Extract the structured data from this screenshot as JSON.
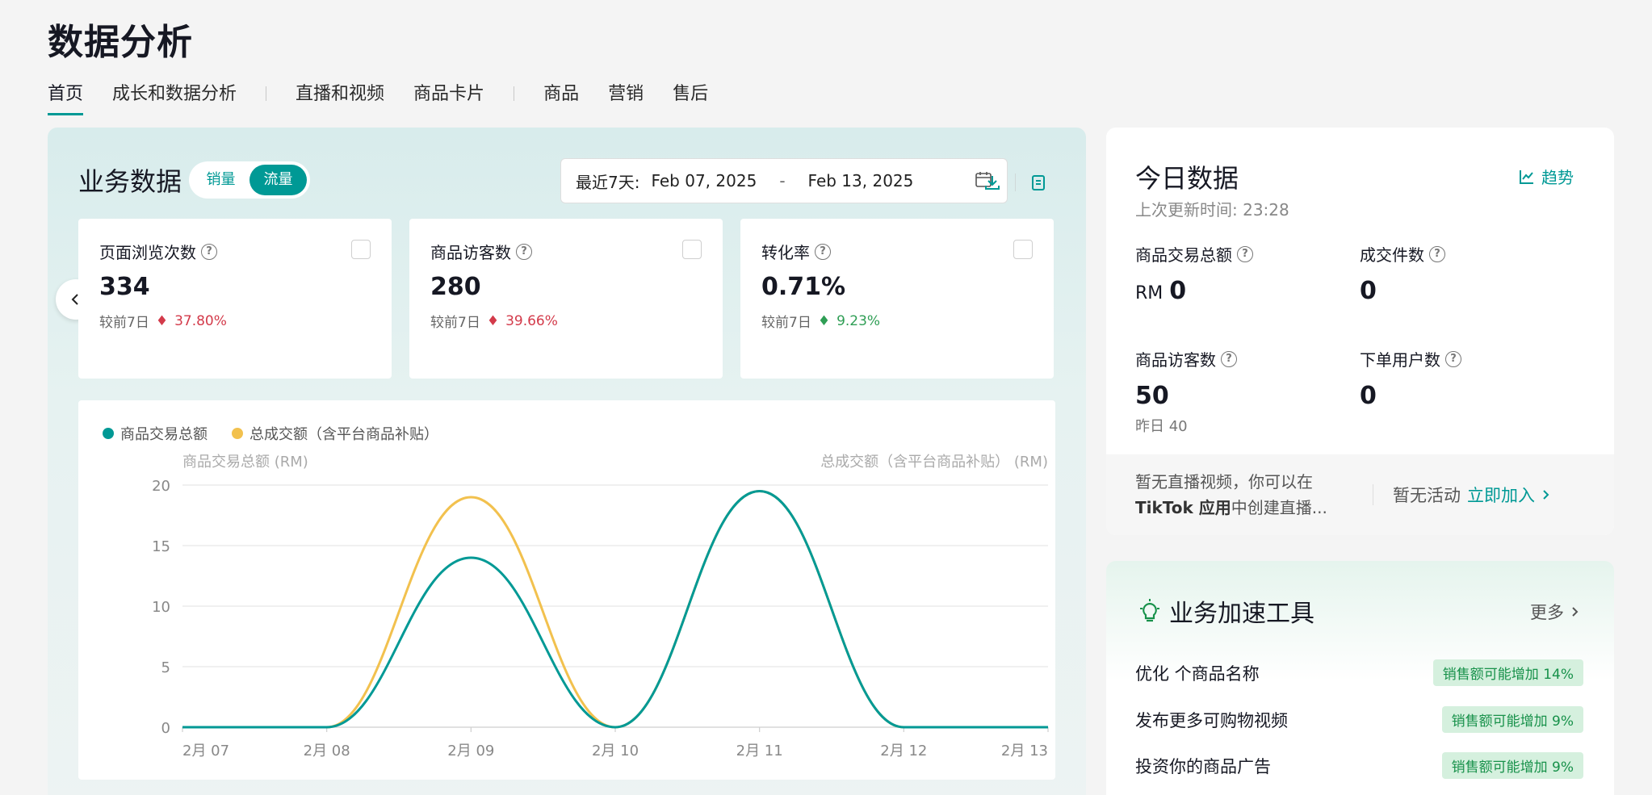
{
  "page_title": "数据分析",
  "nav": [
    {
      "label": "首页",
      "active": true
    },
    {
      "label": "成长和数据分析"
    },
    {
      "label": "直播和视频"
    },
    {
      "label": "商品卡片"
    },
    {
      "label": "商品"
    },
    {
      "label": "营销"
    },
    {
      "label": "售后"
    }
  ],
  "business": {
    "title": "业务数据",
    "toggle": {
      "sales": "销量",
      "traffic": "流量"
    },
    "date_label": "最近7天:",
    "date_start": "Feb 07, 2025",
    "date_sep": "-",
    "date_end": "Feb 13, 2025",
    "metrics": [
      {
        "name": "页面浏览次数",
        "value": "334",
        "cmp_label": "较前7日",
        "change": "37.80%",
        "dir": "down"
      },
      {
        "name": "商品访客数",
        "value": "280",
        "cmp_label": "较前7日",
        "change": "39.66%",
        "dir": "down"
      },
      {
        "name": "转化率",
        "value": "0.71%",
        "cmp_label": "较前7日",
        "change": "9.23%",
        "dir": "up"
      }
    ]
  },
  "chart_data": {
    "type": "line",
    "legend_placement": "top-left",
    "categories": [
      "2月 07",
      "2月 08",
      "2月 09",
      "2月 10",
      "2月 11",
      "2月 12",
      "2月 13"
    ],
    "series": [
      {
        "name": "商品交易总额",
        "color": "#009995",
        "values": [
          0,
          0,
          14,
          0,
          19.5,
          0,
          0
        ]
      },
      {
        "name": "总成交额（含平台商品补贴）",
        "color": "#f2c14e",
        "values": [
          0,
          0,
          19,
          0,
          19.5,
          0,
          0
        ]
      }
    ],
    "ylabel_left": "商品交易总额 (RM)",
    "ylabel_right": "总成交额（含平台商品补贴） (RM)",
    "yticks": [
      "0",
      "5",
      "10",
      "15",
      "20"
    ],
    "ylim": [
      0,
      20
    ],
    "grid": true
  },
  "today": {
    "title": "今日数据",
    "trend_label": "趋势",
    "updated_label": "上次更新时间:",
    "updated_time": "23:28",
    "kpis": {
      "gmv": {
        "name": "商品交易总额",
        "currency": "RM",
        "value": "0"
      },
      "orders": {
        "name": "成交件数",
        "value": "0"
      },
      "visitors": {
        "name": "商品访客数",
        "value": "50",
        "sub": "昨日 40"
      },
      "buyers": {
        "name": "下单用户数",
        "value": "0"
      }
    },
    "strip": {
      "line1": "暂无直播视频，你可以在",
      "line2_bold": "TikTok 应用",
      "line2_rest": "中创建直播...",
      "activity": "暂无活动",
      "join": "立即加入"
    }
  },
  "tools": {
    "title": "业务加速工具",
    "more": "更多",
    "items": [
      {
        "label": "优化 个商品名称",
        "badge": "销售额可能增加 14%"
      },
      {
        "label": "发布更多可购物视频",
        "badge": "销售额可能增加 9%"
      },
      {
        "label": "投资你的商品广告",
        "badge": "销售额可能增加 9%"
      }
    ]
  }
}
